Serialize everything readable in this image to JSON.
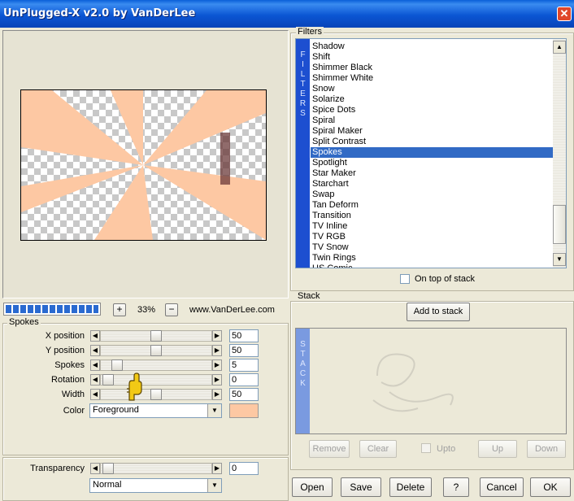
{
  "window": {
    "title": "UnPlugged-X v2.0 by VanDerLee"
  },
  "zoom": {
    "value": "33%",
    "plus": "+",
    "minus": "−",
    "website": "www.VanDerLee.com"
  },
  "spokes_group": {
    "legend": "Spokes",
    "rows": [
      {
        "label": "X position",
        "value": "50"
      },
      {
        "label": "Y position",
        "value": "50"
      },
      {
        "label": "Spokes",
        "value": "5"
      },
      {
        "label": "Rotation",
        "value": "0"
      },
      {
        "label": "Width",
        "value": "50"
      }
    ],
    "color_label": "Color",
    "color_value": "Foreground",
    "color_swatch": "#fdc8a3"
  },
  "transparency": {
    "label": "Transparency",
    "value": "0",
    "blend_mode": "Normal"
  },
  "filters": {
    "legend": "Filters",
    "side_label": "FILTERS",
    "items": [
      "Shadow",
      "Shift",
      "Shimmer Black",
      "Shimmer White",
      "Snow",
      "Solarize",
      "Spice Dots",
      "Spiral",
      "Spiral Maker",
      "Split Contrast",
      "Spokes",
      "Spotlight",
      "Star Maker",
      "Starchart",
      "Swap",
      "Tan Deform",
      "Transition",
      "TV Inline",
      "TV RGB",
      "TV Snow",
      "Twin Rings",
      "US Comic"
    ],
    "selected": "Spokes",
    "on_top_label": "On top of stack"
  },
  "stack": {
    "legend": "Stack",
    "add_label": "Add to stack",
    "side_label": "STACK",
    "remove_label": "Remove",
    "clear_label": "Clear",
    "upto_label": "Upto",
    "up_label": "Up",
    "down_label": "Down"
  },
  "buttons": {
    "open": "Open",
    "save": "Save",
    "delete": "Delete",
    "help": "?",
    "cancel": "Cancel",
    "ok": "OK"
  },
  "colors": {
    "accent": "#0b56d4",
    "selection": "#316ac5",
    "progress": "#2a6ad0",
    "side_label": "#1d4fd0"
  }
}
